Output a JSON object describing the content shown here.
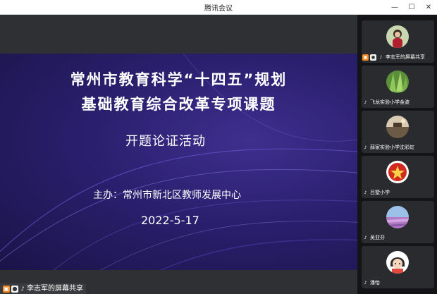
{
  "window": {
    "title": "腾讯会议",
    "min": "—",
    "max": "☐",
    "close": "✕"
  },
  "slide": {
    "title_line1": "常州市教育科学“十四五”规划",
    "title_line2": "基础教育综合改革专项课题",
    "subtitle": "开题论证活动",
    "host": "主办：常州市新北区教师发展中心",
    "date": "2022-5-17"
  },
  "share_badge": {
    "label": "李志军的屏幕共享",
    "icons": [
      "screen-share-icon",
      "presenter-icon",
      "mic-icon"
    ]
  },
  "participants": [
    {
      "name": "李志军的屏幕共享",
      "avatar": "photo-person"
    },
    {
      "name": "飞龙实验小学金波",
      "avatar": "photo-plant"
    },
    {
      "name": "薛家实验小学沈彩虹",
      "avatar": "photo-landscape"
    },
    {
      "name": "吕墅小学",
      "avatar": "photo-badge"
    },
    {
      "name": "吴亚芬",
      "avatar": "photo-field"
    },
    {
      "name": "潘怡",
      "avatar": "cartoon-girl"
    }
  ],
  "colors": {
    "slide_bg": "#2a1f6e",
    "accent_orange": "#f08a24",
    "sidebar_bg": "#141416"
  }
}
